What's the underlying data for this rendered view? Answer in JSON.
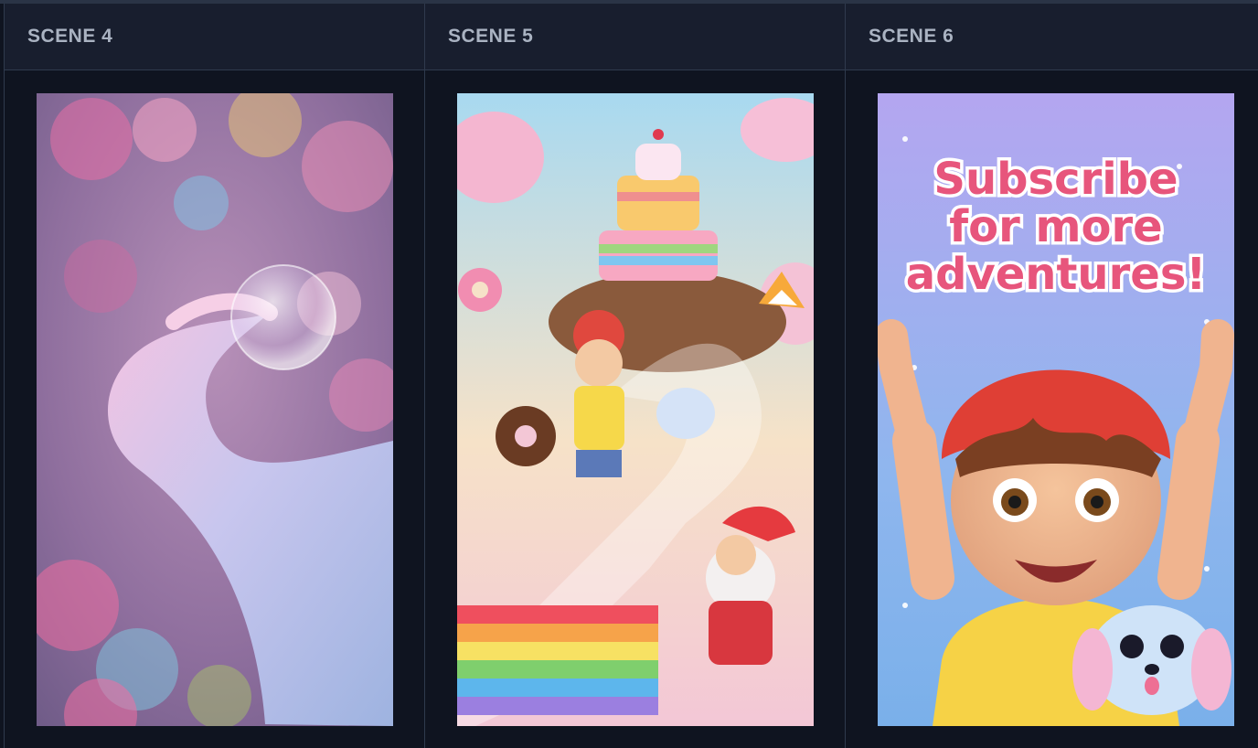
{
  "scenes": [
    {
      "label": "SCENE 4",
      "image_icon": "fluffy-tail-bubble-image"
    },
    {
      "label": "SCENE 5",
      "image_icon": "rainbow-stairs-candy-land-image"
    },
    {
      "label": "SCENE 6",
      "image_icon": "subscribe-boy-puppy-image",
      "overlay_text": [
        "Subscribe",
        "for more",
        "adventures!"
      ]
    }
  ],
  "colors": {
    "background": "#0f1420",
    "header": "#181e2e",
    "divider": "#2f3a4d",
    "label": "#aab3c2"
  }
}
